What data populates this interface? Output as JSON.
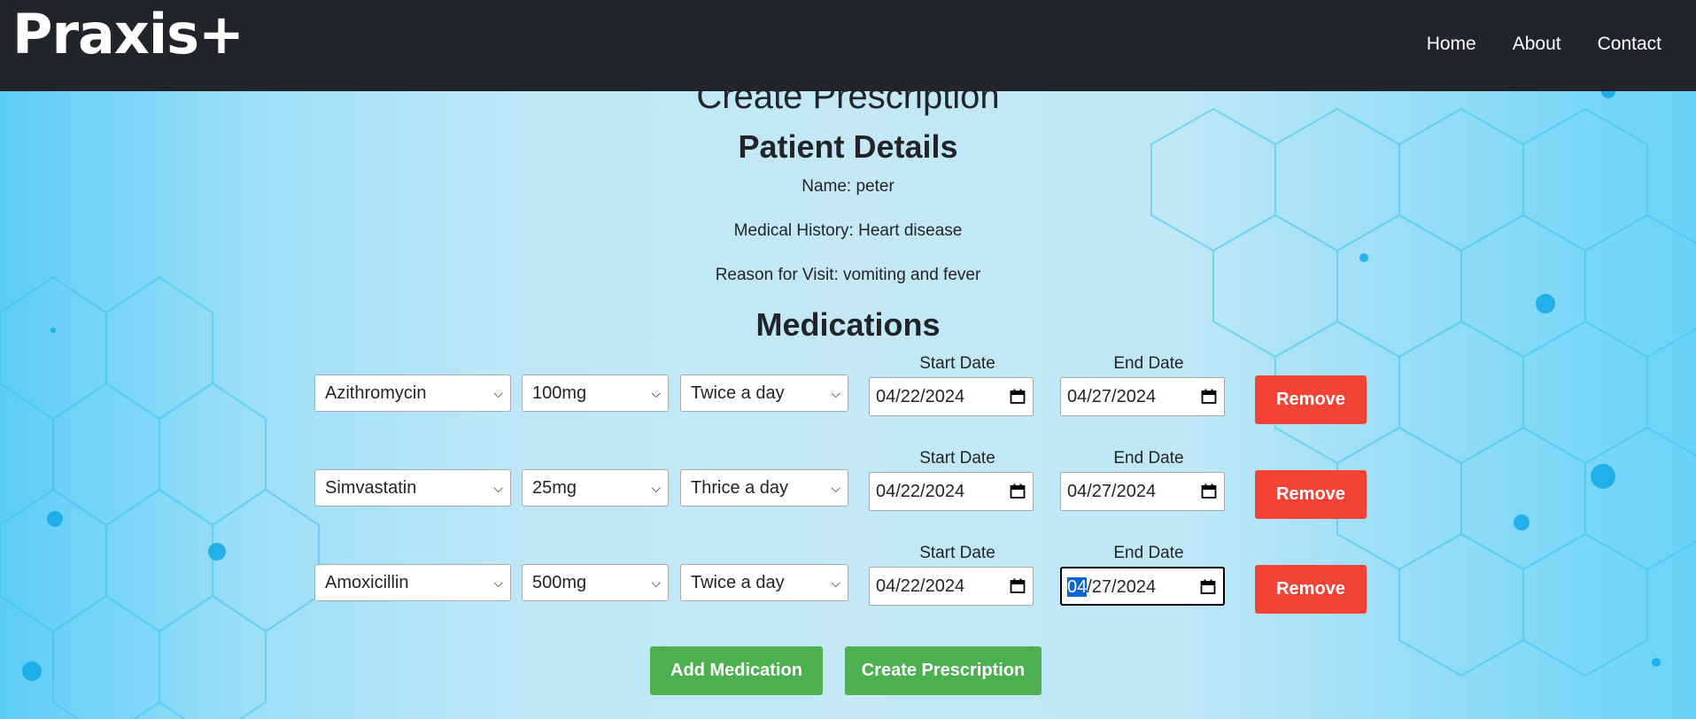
{
  "nav": {
    "brand": "Praxis+",
    "links": [
      "Home",
      "About",
      "Contact"
    ]
  },
  "page": {
    "title": "Create Prescription",
    "patient_heading": "Patient Details",
    "patient_name": "Name: peter",
    "medical_history": "Medical History: Heart disease",
    "reason": "Reason for Visit: vomiting and fever",
    "medications_heading": "Medications"
  },
  "labels": {
    "start_date": "Start Date",
    "end_date": "End Date",
    "remove": "Remove"
  },
  "medications": [
    {
      "drug": "Azithromycin",
      "dose": "100mg",
      "frequency": "Twice a day",
      "start": "04/22/2024",
      "end": "04/27/2024"
    },
    {
      "drug": "Simvastatin",
      "dose": "25mg",
      "frequency": "Thrice a day",
      "start": "04/22/2024",
      "end": "04/27/2024"
    },
    {
      "drug": "Amoxicillin",
      "dose": "500mg",
      "frequency": "Twice a day",
      "start": "04/22/2024",
      "end_hl": "04",
      "end_rest": "/27/2024"
    }
  ],
  "actions": {
    "add_medication": "Add Medication",
    "create_prescription": "Create Prescription"
  },
  "colors": {
    "navbar": "#212529",
    "remove": "#f44336",
    "green": "#4caf50",
    "selection": "#0a64d6"
  }
}
